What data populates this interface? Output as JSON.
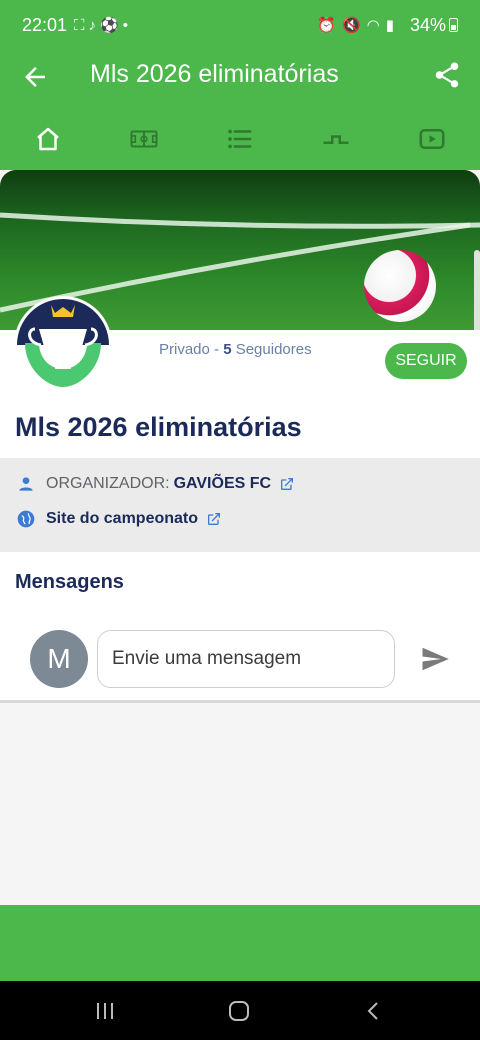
{
  "status_bar": {
    "time": "22:01",
    "battery": "34%",
    "icons_left": [
      "screenshot-icon",
      "tiktok-icon",
      "soccer-icon",
      "dot-icon"
    ],
    "icons_right": [
      "alarm-icon",
      "mute-icon",
      "wifi-icon",
      "volte-icon",
      "signal-icon",
      "battery-icon"
    ]
  },
  "app_bar": {
    "title": "Mls 2026 eliminatórias",
    "back_icon": "arrow-back-icon",
    "share_icon": "share-icon"
  },
  "tabs": [
    {
      "icon": "home-icon",
      "active": true
    },
    {
      "icon": "field-icon",
      "active": false
    },
    {
      "icon": "list-icon",
      "active": false
    },
    {
      "icon": "bracket-icon",
      "active": false
    },
    {
      "icon": "video-icon",
      "active": false
    }
  ],
  "profile": {
    "privacy": "Privado",
    "separator": " - ",
    "followers_count": "5",
    "followers_label": " Seguidores",
    "follow_button": "SEGUIR",
    "title": "Mls 2026 eliminatórias"
  },
  "info": {
    "organizer_label": "ORGANIZADOR:",
    "organizer_value": "GAVIÕES FC",
    "site_label": "Site do campeonato"
  },
  "messages": {
    "heading": "Mensagens",
    "avatar_letter": "M",
    "placeholder": "Envie uma mensagem"
  },
  "colors": {
    "brand_green": "#4cb84c",
    "navy": "#1c2a5a",
    "muted_blue": "#6a7fa6"
  }
}
